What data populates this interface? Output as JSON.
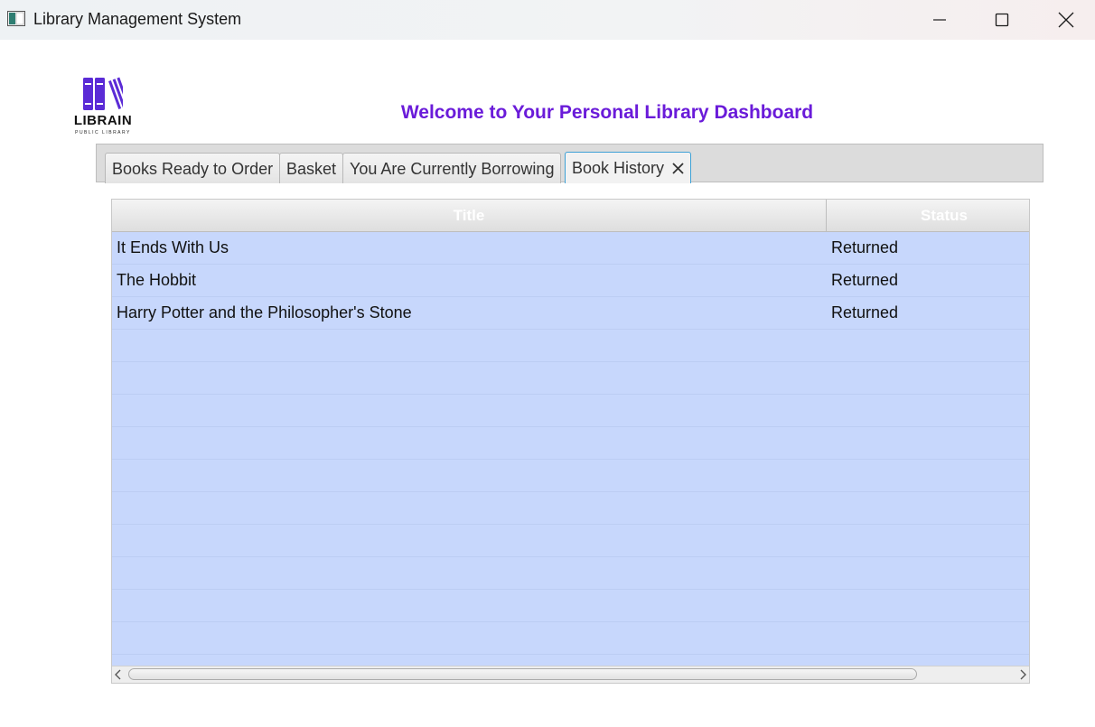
{
  "window": {
    "title": "Library Management System"
  },
  "logo": {
    "name": "LIBRAIN",
    "tagline": "PUBLIC LIBRARY",
    "color": "#5b2bd6"
  },
  "header": {
    "heading": "Welcome to Your Personal Library Dashboard",
    "color": "#6a1bd9"
  },
  "tabs": [
    {
      "label": "Books Ready to Order"
    },
    {
      "label": "Basket"
    },
    {
      "label": "You Are Currently Borrowing"
    },
    {
      "label": "Book History",
      "selected": true,
      "closable": true
    }
  ],
  "table": {
    "columns": [
      "Title",
      "Status"
    ],
    "rows": [
      {
        "title": "It Ends With Us",
        "status": "Returned"
      },
      {
        "title": "The Hobbit",
        "status": "Returned"
      },
      {
        "title": "Harry Potter and the Philosopher's Stone",
        "status": "Returned"
      }
    ],
    "row_color": "#c7d7fc"
  },
  "icons": {
    "app": "app-window-icon",
    "minimize": "minimize-icon",
    "maximize": "maximize-icon",
    "close": "close-icon",
    "tab_close": "tab-close-icon",
    "scroll_left": "chevron-left-icon",
    "scroll_right": "chevron-right-icon"
  }
}
